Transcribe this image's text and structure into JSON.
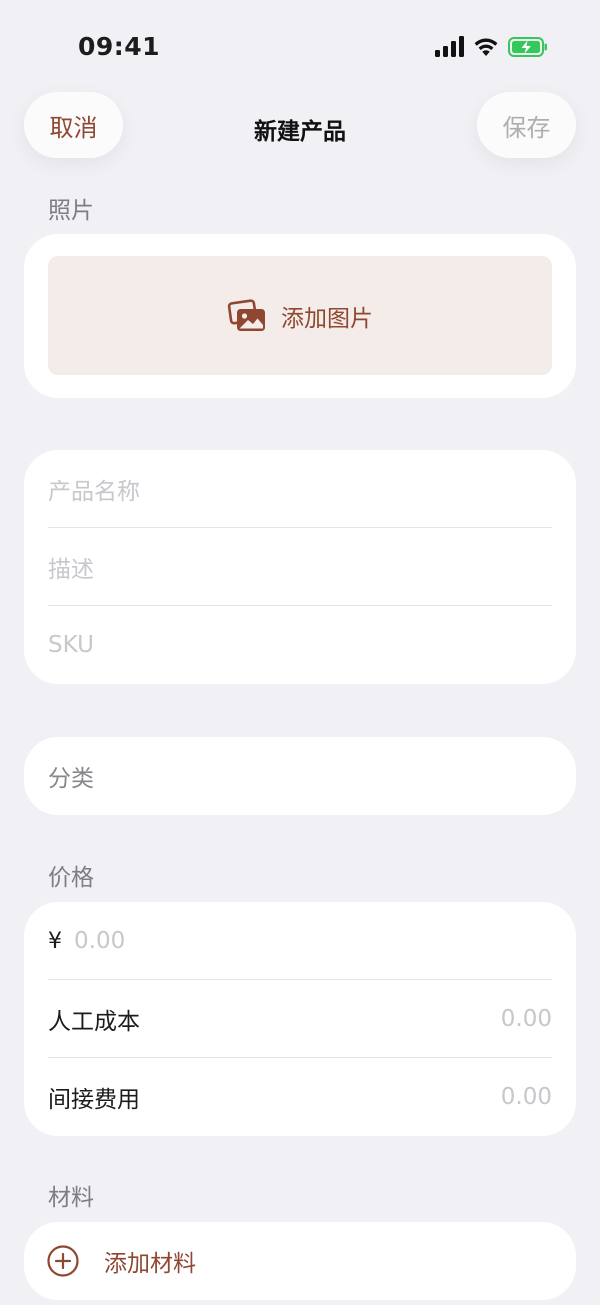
{
  "status": {
    "time": "09:41"
  },
  "nav": {
    "cancel": "取消",
    "title": "新建产品",
    "save": "保存"
  },
  "photos": {
    "section_label": "照片",
    "add_image": "添加图片",
    "icon": "photo-stack-icon"
  },
  "info": {
    "name_placeholder": "产品名称",
    "description_placeholder": "描述",
    "sku_placeholder": "SKU"
  },
  "category": {
    "label": "分类"
  },
  "price": {
    "section_label": "价格",
    "currency_symbol": "¥",
    "price_placeholder": "0.00",
    "labor_cost_label": "人工成本",
    "labor_cost_value": "0.00",
    "overhead_label": "间接费用",
    "overhead_value": "0.00"
  },
  "materials": {
    "section_label": "材料",
    "add_material": "添加材料",
    "icon": "plus-circle-icon"
  },
  "colors": {
    "accent": "#8f4731",
    "background": "#f1f0f5",
    "placeholder": "#c7c7cc",
    "battery": "#34c759"
  }
}
